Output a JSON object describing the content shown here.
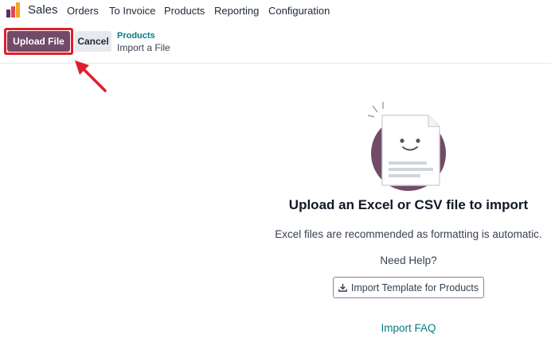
{
  "nav": {
    "app_name": "Sales",
    "menu": [
      "Orders",
      "To Invoice",
      "Products",
      "Reporting",
      "Configuration"
    ]
  },
  "control_panel": {
    "upload_label": "Upload File",
    "cancel_label": "Cancel",
    "breadcrumb_parent": "Products",
    "breadcrumb_current": "Import a File"
  },
  "empty_state": {
    "title": "Upload an Excel or CSV file to import",
    "description": "Excel files are recommended as formatting is automatic.",
    "help_text": "Need Help?",
    "template_button": "Import Template for Products",
    "faq_link": "Import FAQ"
  },
  "colors": {
    "brand": "#714b67",
    "link": "#017e84",
    "highlight": "#e11d2b"
  },
  "icons": [
    "app-logo-icon",
    "download-icon",
    "annotation-arrow-icon",
    "document-illustration-icon"
  ]
}
